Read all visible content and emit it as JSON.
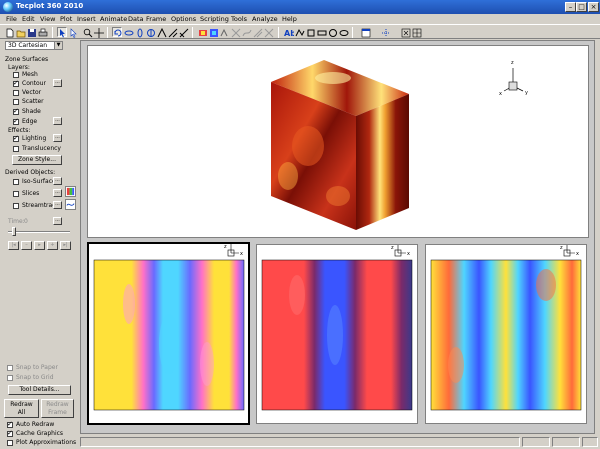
{
  "window": {
    "title": "Tecplot 360 2010"
  },
  "menu": [
    "File",
    "Edit",
    "View",
    "Plot",
    "Insert",
    "Animate",
    "Data",
    "Frame",
    "Options",
    "Scripting",
    "Tools",
    "Analyze",
    "Help"
  ],
  "sidebar": {
    "plot_type": "3D Cartesian",
    "zone_surfaces_label": "Zone Surfaces",
    "layers_label": "Layers:",
    "layers": [
      {
        "label": "Mesh",
        "checked": false
      },
      {
        "label": "Contour",
        "checked": true
      },
      {
        "label": "Vector",
        "checked": false
      },
      {
        "label": "Scatter",
        "checked": false
      },
      {
        "label": "Shade",
        "checked": true
      },
      {
        "label": "Edge",
        "checked": true
      }
    ],
    "effects_label": "Effects:",
    "effects": [
      {
        "label": "Lighting",
        "checked": true
      },
      {
        "label": "Translucency",
        "checked": false
      }
    ],
    "zone_style_button": "Zone Style...",
    "derived_label": "Derived Objects:",
    "derived": [
      {
        "label": "Iso-Surfaces",
        "checked": false
      },
      {
        "label": "Slices",
        "checked": false
      },
      {
        "label": "Streamtraces",
        "checked": false
      }
    ],
    "time_label": "Time:",
    "time_value": "0",
    "snap_paper": "Snap to Paper",
    "snap_grid": "Snap to Grid",
    "tool_details_button": "Tool Details...",
    "redraw_all": [
      "Redraw",
      "All"
    ],
    "redraw_frame": [
      "Redraw",
      "Frame"
    ],
    "auto_redraw": "Auto Redraw",
    "cache_graphics": "Cache Graphics",
    "plot_approximations": "Plot Approximations",
    "auto_redraw_checked": true,
    "cache_graphics_checked": true,
    "plot_approximations_checked": false
  },
  "axes": {
    "x": "x",
    "y": "y",
    "z": "z"
  },
  "colors": {
    "accent_blue": "#1e4fb0",
    "contour_red": "#e84040",
    "contour_yellow": "#ffe13a",
    "contour_blue": "#3a55ff",
    "contour_cyan": "#4fd6ff"
  }
}
